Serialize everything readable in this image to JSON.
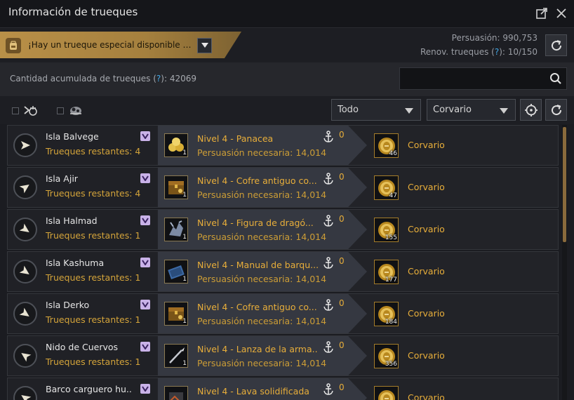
{
  "window": {
    "title": "Información de trueques"
  },
  "banner": {
    "text": "¡Hay un trueque especial disponible en ..."
  },
  "stats": {
    "persuasion": "Persuasión: 990,753",
    "renov_prefix": "Renov. trueques (",
    "renov_q": "?",
    "renov_suffix": "): 10/150"
  },
  "accum": {
    "prefix": "Cantidad acumulada de trueques (",
    "q": "?",
    "suffix": "): 42069"
  },
  "search": {
    "value": "",
    "placeholder": ""
  },
  "filters": {
    "type_select": "Todo",
    "region_select": "Corvario"
  },
  "rows": [
    {
      "island": "Isla Balvege",
      "remaining": "Trueques restantes: 4",
      "item": "Nivel 4 - Panacea",
      "item_icon": "gold-pills-icon",
      "item_count": "1",
      "req": "Persuasión necesaria: 14,014",
      "anchor": "0",
      "reward_icon": "gold-coin-icon",
      "reward_count": "46",
      "reward": "Corvario",
      "nav_dir": "right"
    },
    {
      "island": "Isla Ajir",
      "remaining": "Trueques restantes: 4",
      "item": "Nivel 4 - Cofre antiguo co...",
      "item_icon": "chest-icon",
      "item_count": "1",
      "req": "Persuasión necesaria: 14,014",
      "anchor": "0",
      "reward_icon": "gold-coin-icon",
      "reward_count": "47",
      "reward": "Corvario",
      "nav_dir": "upright"
    },
    {
      "island": "Isla Halmad",
      "remaining": "Trueques restantes: 1",
      "item": "Nivel 4 - Figura de dragó...",
      "item_icon": "dragon-figure-icon",
      "item_count": "1",
      "req": "Persuasión necesaria: 14,014",
      "anchor": "0",
      "reward_icon": "gold-coin-icon",
      "reward_count": "155",
      "reward": "Corvario",
      "nav_dir": "downright"
    },
    {
      "island": "Isla Kashuma",
      "remaining": "Trueques restantes: 1",
      "item": "Nivel 4 - Manual de barqu...",
      "item_icon": "manual-icon",
      "item_count": "1",
      "req": "Persuasión necesaria: 14,014",
      "anchor": "0",
      "reward_icon": "gold-coin-icon",
      "reward_count": "177",
      "reward": "Corvario",
      "nav_dir": "downright"
    },
    {
      "island": "Isla Derko",
      "remaining": "Trueques restantes: 1",
      "item": "Nivel 4 - Cofre antiguo co...",
      "item_icon": "chest-icon",
      "item_count": "1",
      "req": "Persuasión necesaria: 14,014",
      "anchor": "0",
      "reward_icon": "gold-coin-icon",
      "reward_count": "184",
      "reward": "Corvario",
      "nav_dir": "downright"
    },
    {
      "island": "Nido de Cuervos",
      "remaining": "Trueques restantes: 1",
      "item": "Nivel 4 - Lanza de la arma...",
      "item_icon": "spear-icon",
      "item_count": "1",
      "req": "Persuasión necesaria: 14,014",
      "anchor": "0",
      "reward_icon": "gold-coin-icon",
      "reward_count": "356",
      "reward": "Corvario",
      "nav_dir": "upleft"
    },
    {
      "island": "Barco carguero hu...",
      "remaining": "",
      "item": "Nivel 4 - Lava solidificada",
      "item_icon": "lava-icon",
      "item_count": "",
      "req": "",
      "anchor": "0",
      "reward_icon": "gold-coin-icon",
      "reward_count": "",
      "reward": "Corvario",
      "nav_dir": "upleft"
    }
  ],
  "colors": {
    "accent_gold": "#e8ae3a",
    "question": "#41a7e6",
    "banner": "#b99048"
  }
}
